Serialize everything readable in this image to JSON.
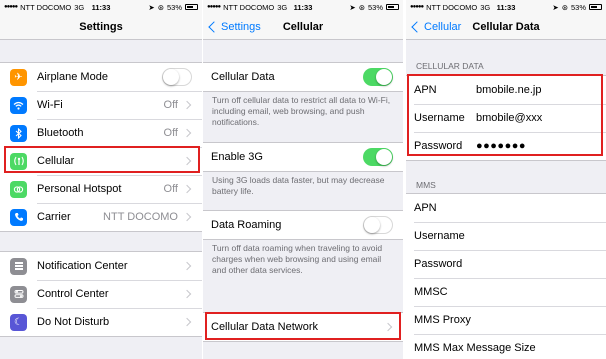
{
  "status_bar": {
    "carrier": "NTT DOCOMO",
    "network": "3G",
    "time": "11:33",
    "battery": "53%"
  },
  "screen_settings": {
    "title": "Settings",
    "group1": [
      {
        "label": "Airplane Mode",
        "icon": "airplane-icon",
        "color": "#ff9500",
        "control": "toggle-off"
      },
      {
        "label": "Wi-Fi",
        "icon": "wifi-icon",
        "color": "#007aff",
        "value": "Off"
      },
      {
        "label": "Bluetooth",
        "icon": "bluetooth-icon",
        "color": "#007aff",
        "value": "Off"
      },
      {
        "label": "Cellular",
        "icon": "cellular-icon",
        "color": "#4cd964",
        "value": ""
      },
      {
        "label": "Personal Hotspot",
        "icon": "hotspot-icon",
        "color": "#4cd964",
        "value": "Off"
      },
      {
        "label": "Carrier",
        "icon": "phone-icon",
        "color": "#007aff",
        "value": "NTT DOCOMO"
      }
    ],
    "group2": [
      {
        "label": "Notification Center",
        "icon": "notification-icon",
        "color": "#8e8e93"
      },
      {
        "label": "Control Center",
        "icon": "control-center-icon",
        "color": "#8e8e93"
      },
      {
        "label": "Do Not Disturb",
        "icon": "moon-icon",
        "color": "#5856d6"
      }
    ]
  },
  "screen_cellular": {
    "back": "Settings",
    "title": "Cellular",
    "cellular_data": {
      "label": "Cellular Data",
      "state": "on"
    },
    "cellular_data_note": "Turn off cellular data to restrict all data to Wi-Fi, including email, web browsing, and push notifications.",
    "enable_3g": {
      "label": "Enable 3G",
      "state": "on"
    },
    "enable_3g_note": "Using 3G loads data faster, but may decrease battery life.",
    "data_roaming": {
      "label": "Data Roaming",
      "state": "off"
    },
    "data_roaming_note": "Turn off data roaming when traveling to avoid charges when web browsing and using email and other data services.",
    "cellular_data_network": "Cellular Data Network"
  },
  "screen_cellular_data": {
    "back": "Cellular",
    "title": "Cellular Data",
    "section_cellular": "CELLULAR DATA",
    "fields": [
      {
        "label": "APN",
        "value": "bmobile.ne.jp"
      },
      {
        "label": "Username",
        "value": "bmobile@xxx"
      },
      {
        "label": "Password",
        "value": "●●●●●●●"
      }
    ],
    "section_mms": "MMS",
    "mms_fields": [
      "APN",
      "Username",
      "Password",
      "MMSC",
      "MMS Proxy",
      "MMS Max Message Size"
    ]
  },
  "colors": {
    "highlight": "#e02020",
    "toggle_on": "#4cd964",
    "accent": "#007aff"
  }
}
